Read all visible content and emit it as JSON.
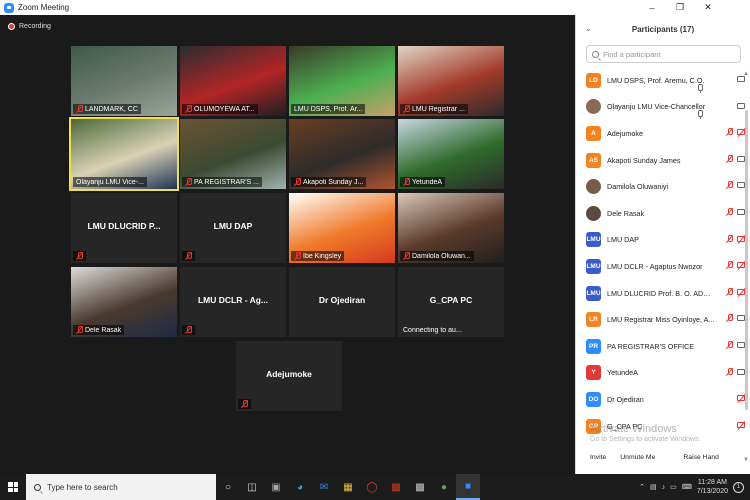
{
  "window": {
    "title": "Zoom Meeting"
  },
  "recording": {
    "label": "Recording"
  },
  "tiles": [
    {
      "name": "LANDMARK, CC",
      "muted": true,
      "colors": [
        "#3d5a4a",
        "#6c7b70",
        "#9aa49b"
      ]
    },
    {
      "name": "OLUMOYEWA AT...",
      "muted": true,
      "colors": [
        "#2a2d33",
        "#b32525",
        "#1f1f24"
      ]
    },
    {
      "name": "LMU DSPS, Prof. Ar...",
      "muted": false,
      "colors": [
        "#3a3a2a",
        "#4caf50",
        "#c7a06a"
      ]
    },
    {
      "name": "LMU Registrar ...",
      "muted": true,
      "colors": [
        "#e0d6c6",
        "#a33a2a",
        "#2b2b2b"
      ]
    },
    {
      "name": "Olayanju LMU Vice-...",
      "muted": false,
      "active": true,
      "colors": [
        "#4b6a3a",
        "#d9d2b5",
        "#1d3355"
      ]
    },
    {
      "name": "PA REGISTRAR'S ...",
      "muted": true,
      "colors": [
        "#6b5334",
        "#3b4a32",
        "#9fb3b1"
      ]
    },
    {
      "name": "Akapoti Sunday J...",
      "muted": true,
      "colors": [
        "#6b3e22",
        "#2d2b2a",
        "#b0552f"
      ]
    },
    {
      "name": "YetundeA",
      "muted": true,
      "colors": [
        "#c8d6e4",
        "#2f6b2c",
        "#2b2b2b"
      ]
    },
    {
      "name": "",
      "label": "LMU DLUCRID P...",
      "muted": true,
      "colors": []
    },
    {
      "name": "",
      "label": "LMU DAP",
      "muted": true,
      "colors": []
    },
    {
      "name": "Ibe Kingsley",
      "muted": true,
      "colors": [
        "#ffffff",
        "#f07a2a",
        "#d43a1f"
      ]
    },
    {
      "name": "Damilola Oluwan...",
      "muted": true,
      "colors": [
        "#d9c8b8",
        "#5a3a2a",
        "#1f1f1f"
      ]
    },
    {
      "name": "Dele Rasak",
      "muted": true,
      "colors": [
        "#dcdcdc",
        "#4a3a2f",
        "#1e2a44"
      ]
    },
    {
      "name": "",
      "label": "LMU DCLR - Ag...",
      "muted": true,
      "colors": []
    },
    {
      "name": "",
      "label": "Dr Ojediran",
      "muted": false,
      "colors": []
    },
    {
      "name": "Connecting to au...",
      "label": "G_CPA PC",
      "muted": false,
      "connecting": true,
      "colors": []
    },
    {
      "name": "",
      "label": "Adejumoke",
      "muted": true,
      "colors": []
    }
  ],
  "participants_panel": {
    "title": "Participants (17)",
    "search_placeholder": "Find a participant",
    "items": [
      {
        "initials": "LD",
        "name": "LMU DSPS, Prof. Aremu, C.O.",
        "color": "#f5821f",
        "mic": "on",
        "cam": "on"
      },
      {
        "initials": "",
        "name": "Olayanju LMU Vice-Chancellor",
        "color": "#8a6a55",
        "mic": "on",
        "cam": "on",
        "photo": true
      },
      {
        "initials": "A",
        "name": "Adejumoke",
        "color": "#f5821f",
        "mic": "off",
        "cam": "off"
      },
      {
        "initials": "AS",
        "name": "Akapoti Sunday James",
        "color": "#f5821f",
        "mic": "off",
        "cam": "on"
      },
      {
        "initials": "",
        "name": "Damilola Oluwaniyi",
        "color": "#7a5a48",
        "mic": "off",
        "cam": "on",
        "photo": true
      },
      {
        "initials": "",
        "name": "Dele Rasak",
        "color": "#5a4a40",
        "mic": "off",
        "cam": "on",
        "photo": true
      },
      {
        "initials": "LMU",
        "name": "LMU DAP",
        "color": "#3b5bcc",
        "mic": "off",
        "cam": "off"
      },
      {
        "initials": "LMU",
        "name": "LMU DCLR - Agaptus Nwozor",
        "color": "#3b5bcc",
        "mic": "off",
        "cam": "off"
      },
      {
        "initials": "LMU",
        "name": "LMU DLUCRID Prof. B. O. ADEB...",
        "color": "#3b5bcc",
        "mic": "off",
        "cam": "off"
      },
      {
        "initials": "LR",
        "name": "LMU Registrar Miss Oyinloye, A...",
        "color": "#f5821f",
        "mic": "off",
        "cam": "on"
      },
      {
        "initials": "PR",
        "name": "PA REGISTRAR'S OFFICE",
        "color": "#2d8cff",
        "mic": "off",
        "cam": "on"
      },
      {
        "initials": "Y",
        "name": "YetundeA",
        "color": "#e53935",
        "mic": "off",
        "cam": "on"
      },
      {
        "initials": "DO",
        "name": "Dr Ojediran",
        "color": "#2d8cff",
        "mic": "none",
        "cam": "off"
      },
      {
        "initials": "GP",
        "name": "G_CPA PC",
        "color": "#f5821f",
        "mic": "none",
        "cam": "off"
      }
    ],
    "buttons": {
      "invite": "Invite",
      "unmute": "Unmute Me",
      "raise": "Raise Hand"
    }
  },
  "watermark": {
    "line1": "Activate Windows",
    "line2": "Go to Settings to activate Windows."
  },
  "taskbar": {
    "search_placeholder": "Type here to search",
    "time": "11:28 AM",
    "date": "7/13/2020",
    "notif_count": "1"
  }
}
